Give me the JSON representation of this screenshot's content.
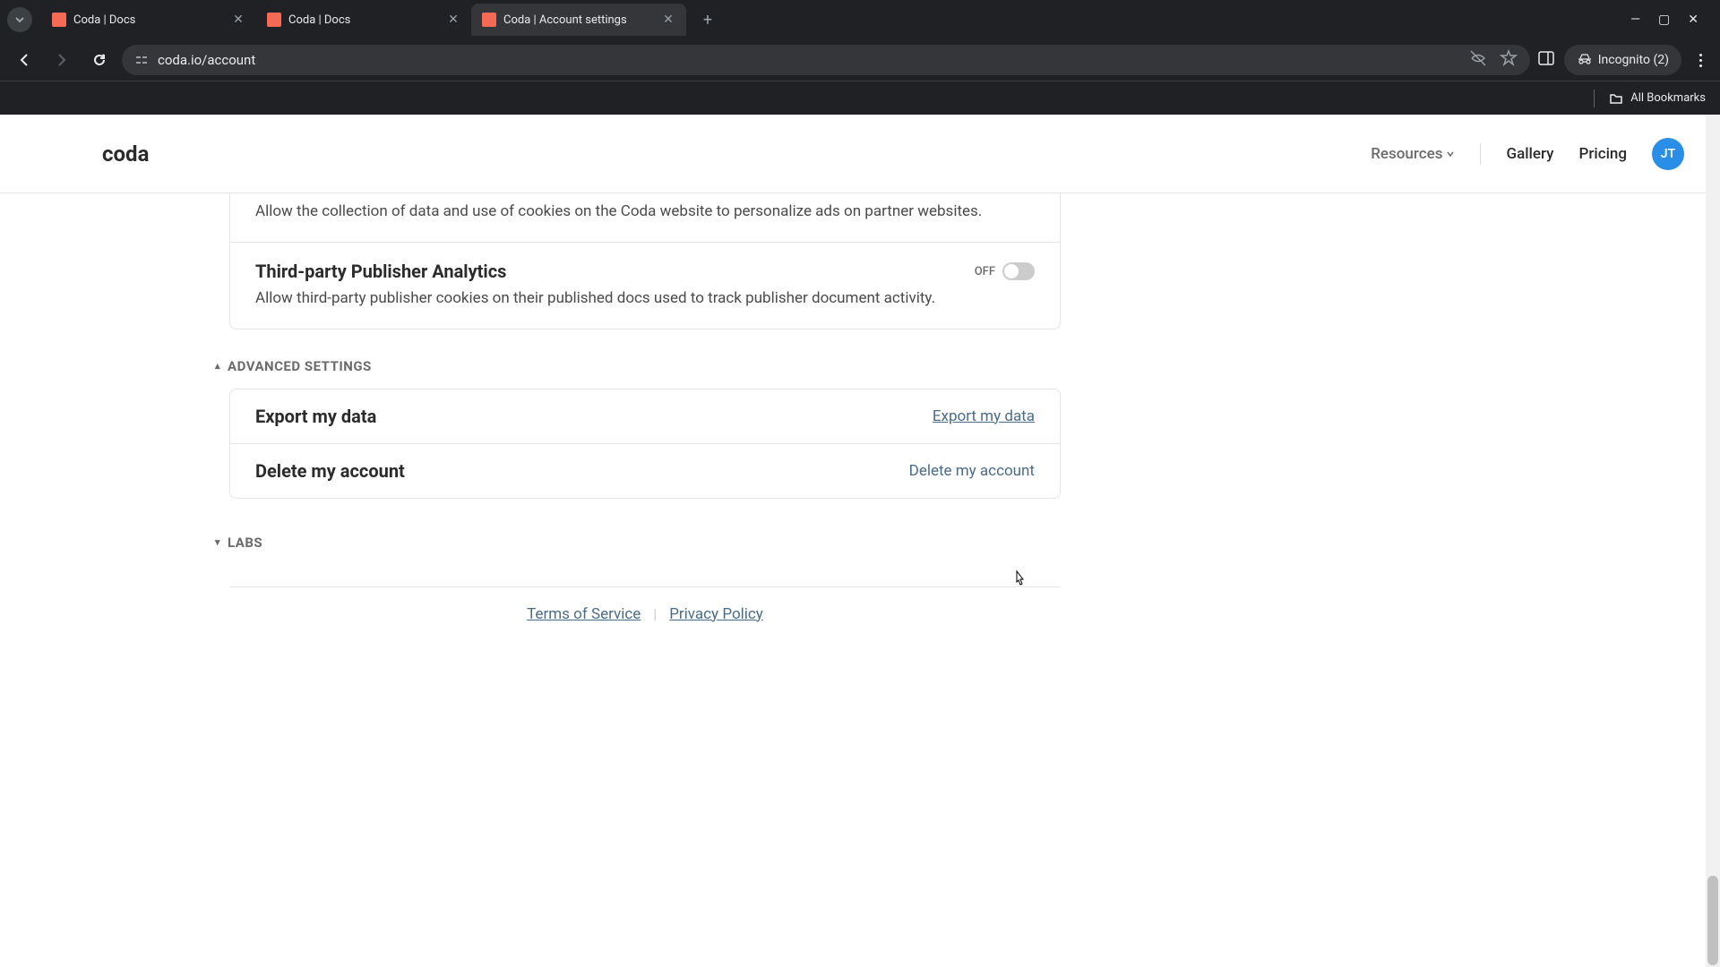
{
  "browser": {
    "tabs": [
      {
        "title": "Coda | Docs",
        "active": false
      },
      {
        "title": "Coda | Docs",
        "active": false
      },
      {
        "title": "Coda | Account settings",
        "active": true
      }
    ],
    "url": "coda.io/account",
    "incognito_label": "Incognito (2)",
    "all_bookmarks": "All Bookmarks"
  },
  "header": {
    "logo": "coda",
    "nav": {
      "resources": "Resources",
      "gallery": "Gallery",
      "pricing": "Pricing"
    },
    "avatar_initials": "JT"
  },
  "settings": {
    "partial_desc": "Allow the collection of data and use of cookies on the Coda website to personalize ads on partner websites.",
    "third_party": {
      "title": "Third-party Publisher Analytics",
      "desc": "Allow third-party publisher cookies on their published docs used to track publisher document activity.",
      "toggle_state": "OFF"
    },
    "advanced_header": "ADVANCED SETTINGS",
    "export": {
      "label": "Export my data",
      "link": "Export my data"
    },
    "delete": {
      "label": "Delete my account",
      "link": "Delete my account"
    },
    "labs_header": "LABS"
  },
  "footer": {
    "terms": "Terms of Service",
    "privacy": "Privacy Policy"
  }
}
